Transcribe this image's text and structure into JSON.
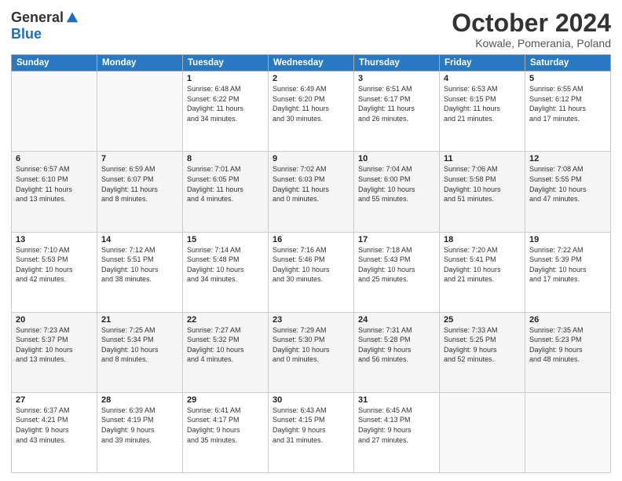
{
  "logo": {
    "general": "General",
    "blue": "Blue"
  },
  "title": "October 2024",
  "subtitle": "Kowale, Pomerania, Poland",
  "headers": [
    "Sunday",
    "Monday",
    "Tuesday",
    "Wednesday",
    "Thursday",
    "Friday",
    "Saturday"
  ],
  "weeks": [
    [
      {
        "day": "",
        "info": ""
      },
      {
        "day": "",
        "info": ""
      },
      {
        "day": "1",
        "info": "Sunrise: 6:48 AM\nSunset: 6:22 PM\nDaylight: 11 hours\nand 34 minutes."
      },
      {
        "day": "2",
        "info": "Sunrise: 6:49 AM\nSunset: 6:20 PM\nDaylight: 11 hours\nand 30 minutes."
      },
      {
        "day": "3",
        "info": "Sunrise: 6:51 AM\nSunset: 6:17 PM\nDaylight: 11 hours\nand 26 minutes."
      },
      {
        "day": "4",
        "info": "Sunrise: 6:53 AM\nSunset: 6:15 PM\nDaylight: 11 hours\nand 21 minutes."
      },
      {
        "day": "5",
        "info": "Sunrise: 6:55 AM\nSunset: 6:12 PM\nDaylight: 11 hours\nand 17 minutes."
      }
    ],
    [
      {
        "day": "6",
        "info": "Sunrise: 6:57 AM\nSunset: 6:10 PM\nDaylight: 11 hours\nand 13 minutes."
      },
      {
        "day": "7",
        "info": "Sunrise: 6:59 AM\nSunset: 6:07 PM\nDaylight: 11 hours\nand 8 minutes."
      },
      {
        "day": "8",
        "info": "Sunrise: 7:01 AM\nSunset: 6:05 PM\nDaylight: 11 hours\nand 4 minutes."
      },
      {
        "day": "9",
        "info": "Sunrise: 7:02 AM\nSunset: 6:03 PM\nDaylight: 11 hours\nand 0 minutes."
      },
      {
        "day": "10",
        "info": "Sunrise: 7:04 AM\nSunset: 6:00 PM\nDaylight: 10 hours\nand 55 minutes."
      },
      {
        "day": "11",
        "info": "Sunrise: 7:06 AM\nSunset: 5:58 PM\nDaylight: 10 hours\nand 51 minutes."
      },
      {
        "day": "12",
        "info": "Sunrise: 7:08 AM\nSunset: 5:55 PM\nDaylight: 10 hours\nand 47 minutes."
      }
    ],
    [
      {
        "day": "13",
        "info": "Sunrise: 7:10 AM\nSunset: 5:53 PM\nDaylight: 10 hours\nand 42 minutes."
      },
      {
        "day": "14",
        "info": "Sunrise: 7:12 AM\nSunset: 5:51 PM\nDaylight: 10 hours\nand 38 minutes."
      },
      {
        "day": "15",
        "info": "Sunrise: 7:14 AM\nSunset: 5:48 PM\nDaylight: 10 hours\nand 34 minutes."
      },
      {
        "day": "16",
        "info": "Sunrise: 7:16 AM\nSunset: 5:46 PM\nDaylight: 10 hours\nand 30 minutes."
      },
      {
        "day": "17",
        "info": "Sunrise: 7:18 AM\nSunset: 5:43 PM\nDaylight: 10 hours\nand 25 minutes."
      },
      {
        "day": "18",
        "info": "Sunrise: 7:20 AM\nSunset: 5:41 PM\nDaylight: 10 hours\nand 21 minutes."
      },
      {
        "day": "19",
        "info": "Sunrise: 7:22 AM\nSunset: 5:39 PM\nDaylight: 10 hours\nand 17 minutes."
      }
    ],
    [
      {
        "day": "20",
        "info": "Sunrise: 7:23 AM\nSunset: 5:37 PM\nDaylight: 10 hours\nand 13 minutes."
      },
      {
        "day": "21",
        "info": "Sunrise: 7:25 AM\nSunset: 5:34 PM\nDaylight: 10 hours\nand 8 minutes."
      },
      {
        "day": "22",
        "info": "Sunrise: 7:27 AM\nSunset: 5:32 PM\nDaylight: 10 hours\nand 4 minutes."
      },
      {
        "day": "23",
        "info": "Sunrise: 7:29 AM\nSunset: 5:30 PM\nDaylight: 10 hours\nand 0 minutes."
      },
      {
        "day": "24",
        "info": "Sunrise: 7:31 AM\nSunset: 5:28 PM\nDaylight: 9 hours\nand 56 minutes."
      },
      {
        "day": "25",
        "info": "Sunrise: 7:33 AM\nSunset: 5:25 PM\nDaylight: 9 hours\nand 52 minutes."
      },
      {
        "day": "26",
        "info": "Sunrise: 7:35 AM\nSunset: 5:23 PM\nDaylight: 9 hours\nand 48 minutes."
      }
    ],
    [
      {
        "day": "27",
        "info": "Sunrise: 6:37 AM\nSunset: 4:21 PM\nDaylight: 9 hours\nand 43 minutes."
      },
      {
        "day": "28",
        "info": "Sunrise: 6:39 AM\nSunset: 4:19 PM\nDaylight: 9 hours\nand 39 minutes."
      },
      {
        "day": "29",
        "info": "Sunrise: 6:41 AM\nSunset: 4:17 PM\nDaylight: 9 hours\nand 35 minutes."
      },
      {
        "day": "30",
        "info": "Sunrise: 6:43 AM\nSunset: 4:15 PM\nDaylight: 9 hours\nand 31 minutes."
      },
      {
        "day": "31",
        "info": "Sunrise: 6:45 AM\nSunset: 4:13 PM\nDaylight: 9 hours\nand 27 minutes."
      },
      {
        "day": "",
        "info": ""
      },
      {
        "day": "",
        "info": ""
      }
    ]
  ]
}
